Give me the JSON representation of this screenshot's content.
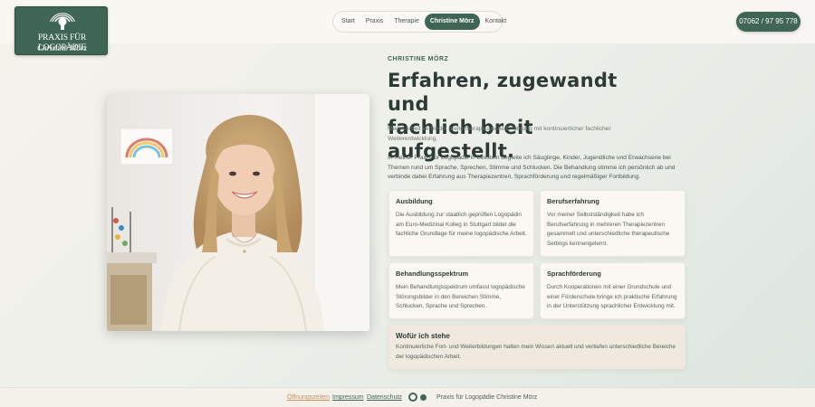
{
  "logo": {
    "title": "PRAXIS FÜR LOGOPÄDIE",
    "signature": "Christine Mörz"
  },
  "nav": {
    "items": [
      {
        "label": "Start",
        "active": false
      },
      {
        "label": "Praxis",
        "active": false
      },
      {
        "label": "Therapie",
        "active": false
      },
      {
        "label": "Christine Mörz",
        "active": true
      },
      {
        "label": "Kontakt",
        "active": false
      }
    ]
  },
  "phone": "07062 / 97 95 778",
  "content": {
    "eyebrow": "CHRISTINE MÖRZ",
    "headline_line1": "Erfahren, zugewandt und",
    "headline_line2": "fachlich breit aufgestellt.",
    "lead": "Meine Arbeit verbindet breite therapeutische Erfahrung mit kontinuierlicher fachlicher Weiterentwicklung.",
    "body": "In meiner Praxis für Logopädie in Beilstein begleite ich Säuglinge, Kinder, Jugendliche und Erwachsene bei Themen rund um Sprache, Sprechen, Stimme und Schlucken. Die Behandlung stimme ich persönlich ab und verbinde dabei Erfahrung aus Therapiezentren, Sprachförderung und regelmäßiger Fortbildung."
  },
  "cards": [
    {
      "title": "Ausbildung",
      "text": "Die Ausbildung zur staatlich geprüften Logopädin am Euro-Medizinal Kolleg in Stuttgart bildet die fachliche Grundlage für meine logopädische Arbeit."
    },
    {
      "title": "Berufserfahrung",
      "text": "Vor meiner Selbstständigkeit habe ich Berufserfahrung in mehreren Therapiezentren gesammelt und unterschiedliche therapeutische Settings kennengelernt."
    },
    {
      "title": "Behandlungsspektrum",
      "text": "Mein Behandlungsspektrum umfasst logopädische Störungsbilder in den Bereichen Stimme, Schlucken, Sprache und Sprechen."
    },
    {
      "title": "Sprachförderung",
      "text": "Durch Kooperationen mit einer Grundschule und einer Förderschule bringe ich praktische Erfahrung in der Unterstützung sprachlicher Entwicklung mit."
    },
    {
      "title": "Wofür ich stehe",
      "text": "Kontinuierliche Fort- und Weiterbildungen halten mein Wissen aktuell und vertiefen unterschiedliche Bereiche der logopädischen Arbeit."
    }
  ],
  "footer": {
    "links": [
      "Öffnungszeiten",
      "Impressum",
      "Datenschutz"
    ],
    "copyright": "Praxis für Logopädie Christine Mörz"
  },
  "colors": {
    "brand": "#3f6555",
    "accent": "#c6925a",
    "card": "#fbf8f3"
  }
}
